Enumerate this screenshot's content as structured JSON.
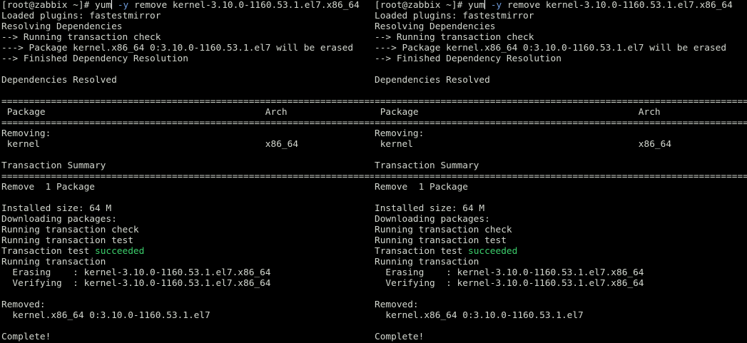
{
  "colors": {
    "background": "#000000",
    "text": "#d3d7cf",
    "success": "#3ccf6c",
    "option": "#6f9ad8"
  },
  "terminal": {
    "command_prompt": "[root@zabbix ~]# ",
    "command_a": "yum",
    "command_option": " -y",
    "command_b": " remove kernel-3.10.0-1160.53.1.el7.x86_64",
    "lines": [
      "Loaded plugins: fastestmirror",
      "Resolving Dependencies",
      "--> Running transaction check",
      "---> Package kernel.x86_64 0:3.10.0-1160.53.1.el7 will be erased",
      "--> Finished Dependency Resolution",
      "",
      "Dependencies Resolved",
      "",
      "============================================================================================================================================================",
      " Package                                        Arch",
      "============================================================================================================================================================",
      "Removing:",
      " kernel                                         x86_64",
      "",
      "Transaction Summary",
      "============================================================================================================================================================",
      "Remove  1 Package",
      "",
      "Installed size: 64 M",
      "Downloading packages:",
      "Running transaction check",
      "Running transaction test"
    ],
    "test_prefix": "Transaction test ",
    "test_status": "succeeded",
    "tail_lines": [
      "Running transaction",
      "  Erasing    : kernel-3.10.0-1160.53.1.el7.x86_64",
      "  Verifying  : kernel-3.10.0-1160.53.1.el7.x86_64",
      "",
      "Removed:",
      "  kernel.x86_64 0:3.10.0-1160.53.1.el7",
      "",
      "Complete!"
    ]
  }
}
